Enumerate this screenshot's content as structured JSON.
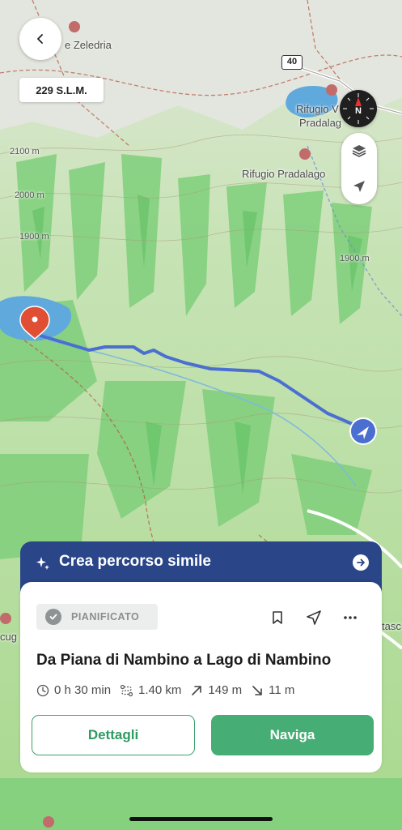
{
  "map": {
    "labels": {
      "rifugio_zeledria": "e Zeledria",
      "rifugio_pradalago_upper": "Rifugio V",
      "pradalago_upper_2": "Pradalag",
      "rifugio_pradalago": "Rifugio Pradalago",
      "elev_2100": "2100 m",
      "elev_2000": "2000 m",
      "elev_1900_left": "1900 m",
      "elev_1900_right": "1900 m",
      "left_edge_cug": "cug",
      "right_edge_tas": "tasc",
      "road_number": "40"
    },
    "colors": {
      "route": "#4a6fd1",
      "terrain_green": "#7fcf7b",
      "water": "#5fa9dc",
      "start_pin": "#e04e33"
    }
  },
  "top": {
    "altitude": "229 S.L.M.",
    "compass_letter": "N"
  },
  "similar": {
    "label": "Crea percorso simile"
  },
  "card": {
    "status": "PIANIFICATO",
    "title": "Da Piana di Nambino a Lago di Nambino",
    "stats": {
      "duration": "0 h 30 min",
      "distance": "1.40 km",
      "ascent": "149 m",
      "descent": "11 m"
    },
    "details_label": "Dettagli",
    "navigate_label": "Naviga"
  }
}
